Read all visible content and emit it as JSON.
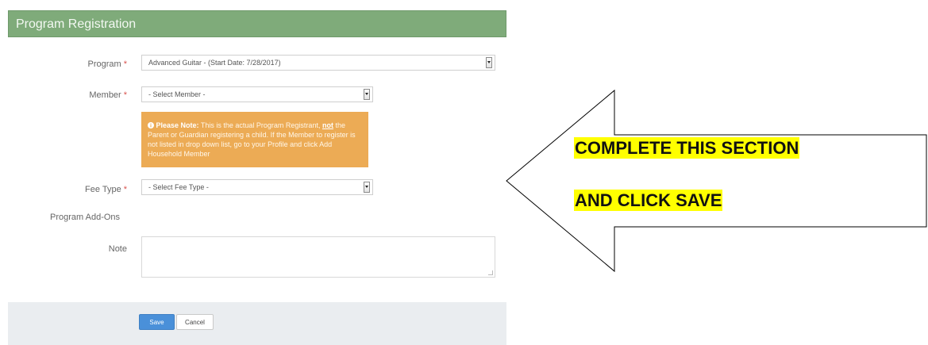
{
  "panel": {
    "title": "Program Registration"
  },
  "form": {
    "program": {
      "label": "Program",
      "required_mark": "*",
      "value": "Advanced Guitar - (Start Date: 7/28/2017)"
    },
    "member": {
      "label": "Member",
      "required_mark": "*",
      "value": "- Select Member -"
    },
    "note_box": {
      "icon": "info-circle-icon",
      "prefix": "Please Note:",
      "text_before_not": " This is the actual Program Registrant, ",
      "not_word": "not",
      "text_after_not": " the Parent or Guardian registering a child. If the Member to register is not listed in drop down list, go to your Profile and click Add Household Member"
    },
    "fee_type": {
      "label": "Fee Type",
      "required_mark": "*",
      "value": "- Select Fee Type -"
    },
    "addons": {
      "label": "Program Add-Ons"
    },
    "note": {
      "label": "Note",
      "value": ""
    }
  },
  "footer": {
    "save_label": "Save",
    "cancel_label": "Cancel"
  },
  "callout": {
    "line1": "COMPLETE THIS SECTION",
    "line2": "AND CLICK SAVE"
  },
  "colors": {
    "header_bg": "#7fab7a",
    "warning_bg": "#ecab55",
    "save_button": "#4a90d9",
    "highlight": "#ffff00"
  }
}
